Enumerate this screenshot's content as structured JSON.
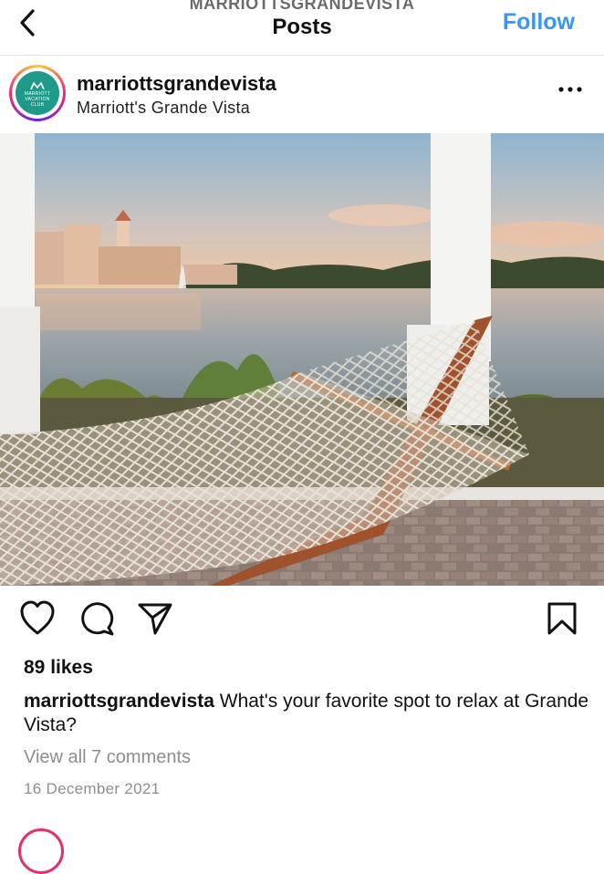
{
  "header": {
    "account": "MARRIOTTSGRANDEVISTA",
    "title": "Posts",
    "follow_label": "Follow"
  },
  "post": {
    "username": "marriottsgrandevista",
    "location": "Marriott's Grande Vista",
    "avatar_lines": [
      "MARRIOTT",
      "VACATION",
      "CLUB"
    ],
    "likes": "89 likes",
    "caption_user": "marriottsgrandevista",
    "caption_text": "What's your favorite spot to relax at Grande Vista?",
    "comments_link": "View all 7 comments",
    "date": "16 December 2021"
  },
  "icons": [
    "back-chevron-icon",
    "more-options-icon",
    "heart-icon",
    "comment-icon",
    "share-icon",
    "bookmark-icon"
  ],
  "colors": {
    "follow_blue": "#3897f0",
    "avatar_teal": "#1f9a8a",
    "muted_gray": "#8e8e8e"
  }
}
